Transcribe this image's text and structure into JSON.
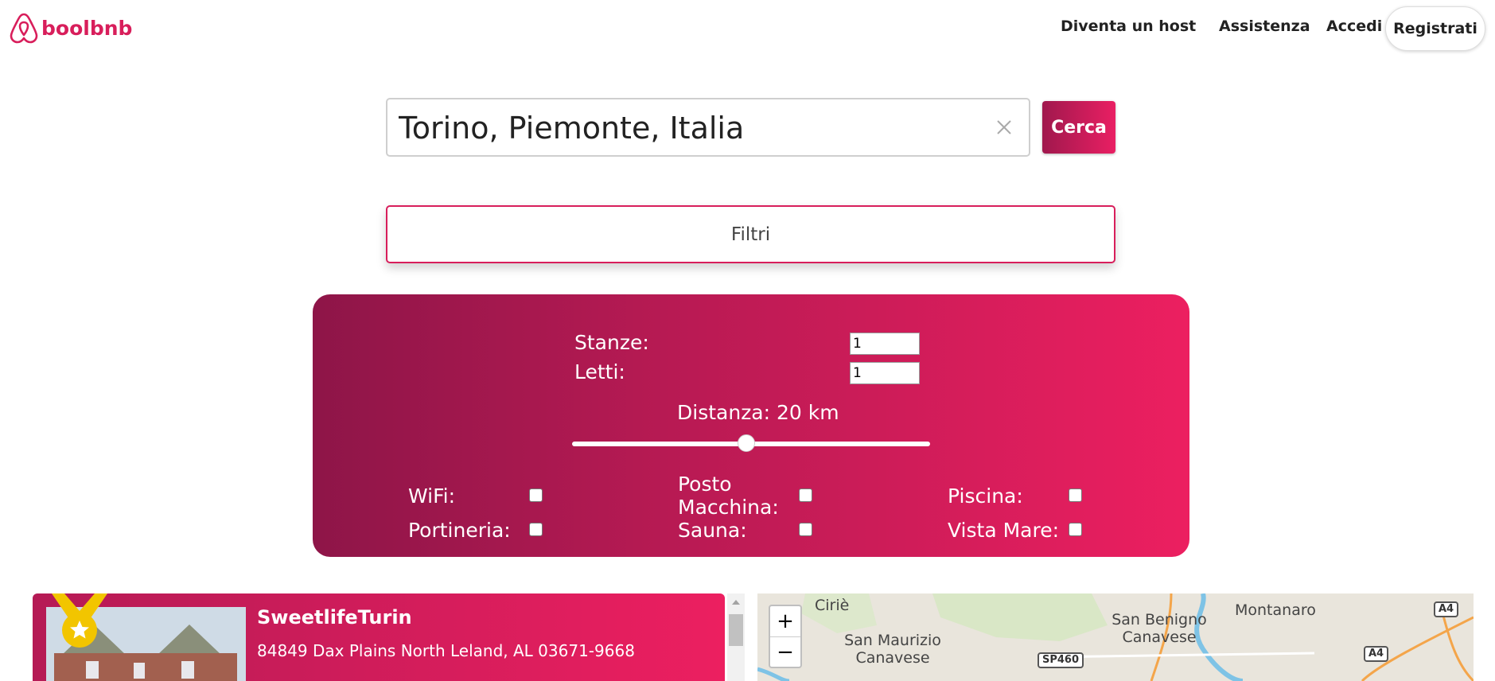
{
  "header": {
    "logo_text": "boolbnb",
    "nav": {
      "host": "Diventa un host",
      "help": "Assistenza",
      "login": "Accedi",
      "register": "Registrati"
    }
  },
  "search": {
    "value": "Torino, Piemonte, Italia",
    "button_label": "Cerca"
  },
  "filters": {
    "toggle_label": "Filtri",
    "rooms_label": "Stanze:",
    "rooms_value": "1",
    "beds_label": "Letti:",
    "beds_value": "1",
    "distance_label": "Distanza: 20 km",
    "distance_level": 0.5,
    "amenities": {
      "wifi": "WiFi:",
      "parking": "Posto Macchina:",
      "pool": "Piscina:",
      "concierge": "Portineria:",
      "sauna": "Sauna:",
      "sea_view": "Vista Mare:"
    }
  },
  "results": {
    "card": {
      "title": "SweetlifeTurin",
      "address": "84849 Dax Plains North Leland, AL 03671-9668"
    }
  },
  "map": {
    "places": {
      "cirie": "Ciriè",
      "san_maurizio": "San Maurizio Canavese",
      "san_benigno": "San Benigno Canavese",
      "montanaro": "Montanaro"
    },
    "roads": {
      "sp460": "SP460",
      "a4_top": "A4",
      "a4_bottom": "A4"
    },
    "zoom_in": "+",
    "zoom_out": "−"
  },
  "colors": {
    "brand": "#d81e5b",
    "gradient_start": "#8e1548",
    "gradient_end": "#ec1f60"
  }
}
